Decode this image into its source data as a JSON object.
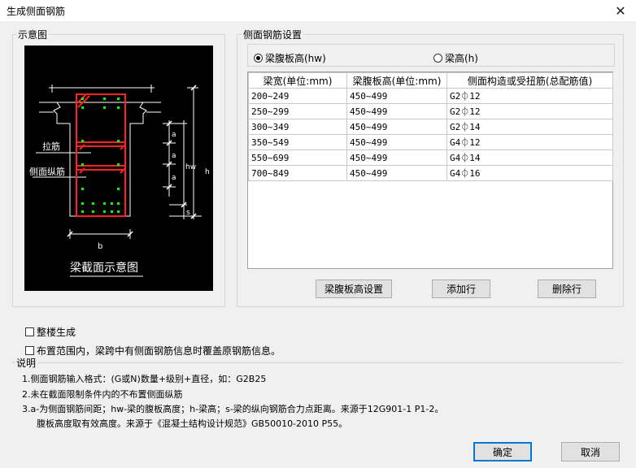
{
  "window": {
    "title": "生成侧面钢筋",
    "close_glyph": "✕"
  },
  "diagram_group": {
    "label": "示意图"
  },
  "diagram": {
    "caption": "梁截面示意图",
    "label_tie": "拉筋",
    "label_side_bar": "侧面纵筋",
    "dim_a1": "a",
    "dim_a2": "a",
    "dim_a3": "a",
    "dim_hw": "hw",
    "dim_h": "h",
    "dim_s": "s",
    "dim_b": "b"
  },
  "settings_group": {
    "label": "侧面钢筋设置"
  },
  "radios": {
    "web_height": "梁腹板高(hw)",
    "beam_height": "梁高(h)",
    "selected": "web_height"
  },
  "table": {
    "columns": [
      "梁宽(单位:mm)",
      "梁腹板高(单位:mm)",
      "侧面构造或受扭筋(总配筋值)"
    ],
    "rows": [
      [
        "200~249",
        "450~499",
        "G2⏀12"
      ],
      [
        "250~299",
        "450~499",
        "G2⏀12"
      ],
      [
        "300~349",
        "450~499",
        "G2⏀14"
      ],
      [
        "350~549",
        "450~499",
        "G4⏀12"
      ],
      [
        "550~699",
        "450~499",
        "G4⏀14"
      ],
      [
        "700~849",
        "450~499",
        "G4⏀16"
      ]
    ]
  },
  "buttons": {
    "web_height_settings": "梁腹板高设置",
    "add_row": "添加行",
    "delete_row": "删除行",
    "ok": "确定",
    "cancel": "取消"
  },
  "checkboxes": {
    "whole_building": "整楼生成",
    "overwrite": "布置范围内，梁跨中有侧面钢筋信息时覆盖原钢筋信息。"
  },
  "notes": {
    "title": "说明",
    "line1": "1.侧面钢筋输入格式：(G或N)数量+级别+直径，如：G2B25",
    "line2": "2.未在截面限制条件内的不布置侧面纵筋",
    "line3": "3.a-为侧面钢筋间距；hw-梁的腹板高度；h-梁高；s-梁的纵向钢筋合力点距离。来源于12G901-1 P1-2。",
    "line4": "腹板高度取有效高度。来源于《混凝土结构设计规范》GB50010-2010 P55。"
  },
  "colors": {
    "accent": "#0078d7",
    "rebar_red": "#ff2020",
    "bar_green": "#00ff00",
    "diagram_bg": "#000000"
  }
}
